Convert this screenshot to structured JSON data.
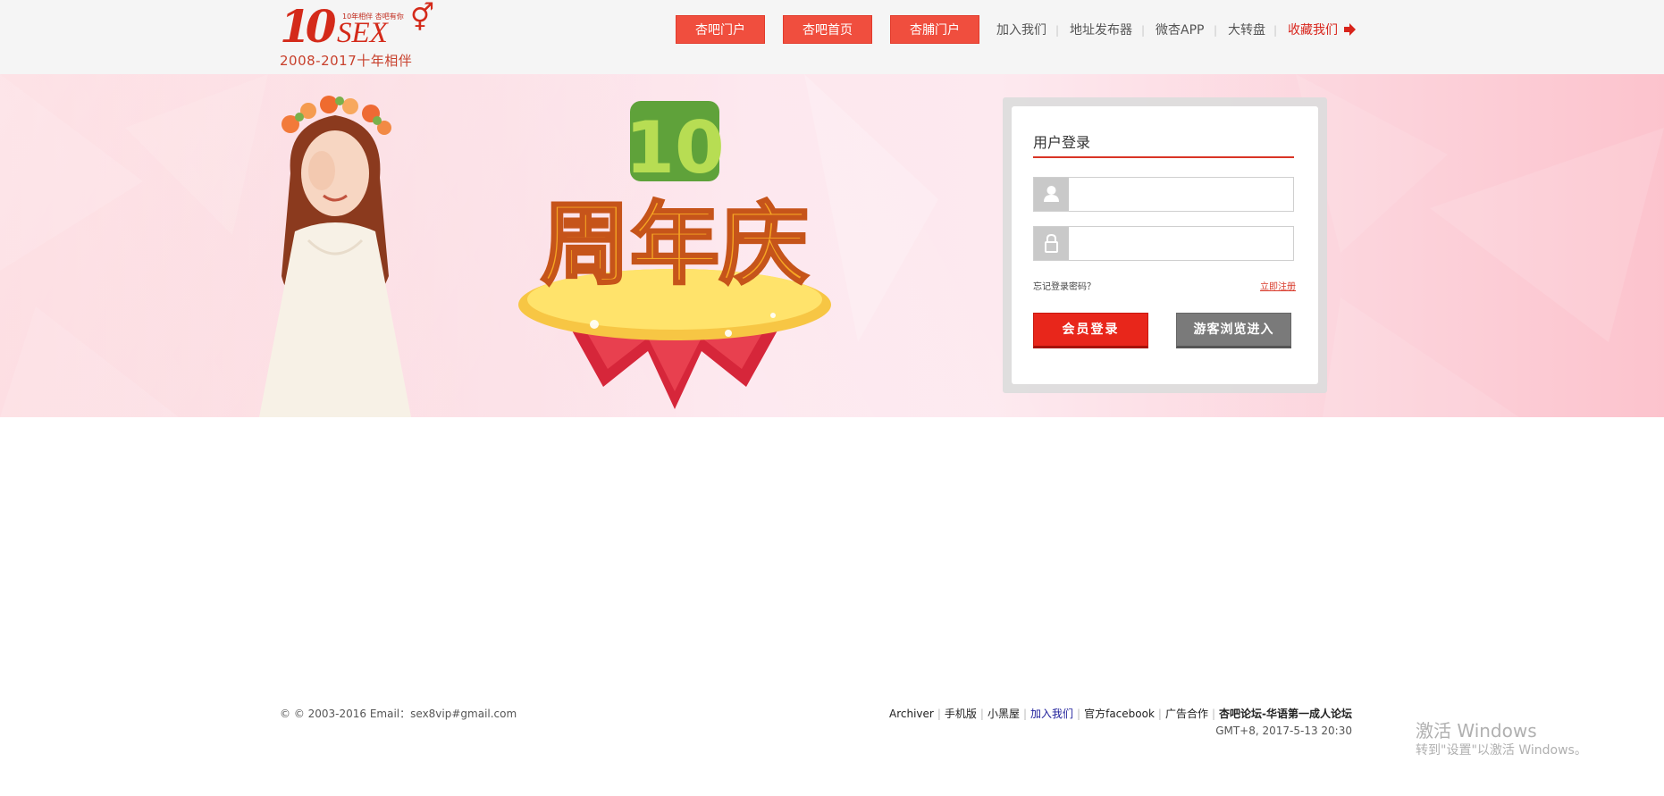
{
  "header": {
    "logo": {
      "tagline": "10年相伴 杏吧有你",
      "brand": "SEX",
      "years": "2008-2017十年相伴"
    },
    "nav_buttons": [
      {
        "label": "杏吧门户"
      },
      {
        "label": "杏吧首页"
      },
      {
        "label": "杏脯门户"
      }
    ],
    "nav_links": [
      {
        "label": "加入我们"
      },
      {
        "label": "地址发布器"
      },
      {
        "label": "微杏APP"
      },
      {
        "label": "大转盘"
      }
    ],
    "favorite_label": "收藏我们",
    "separator": "|"
  },
  "banner": {
    "anniversary_number": "10",
    "anniversary_text": "周年庆"
  },
  "login": {
    "title": "用户登录",
    "username_value": "",
    "password_value": "",
    "forgot_label": "忘记登录密码？",
    "register_label": "立即注册",
    "login_button": "会员登录",
    "guest_button": "游客浏览进入"
  },
  "footer": {
    "copyright": "© © 2003-2016 Email：sex8vip#gmail.com",
    "links": {
      "archiver": "Archiver",
      "mobile": "手机版",
      "blackroom": "小黑屋",
      "join": "加入我们",
      "facebook": "官方facebook",
      "ads": "广告合作",
      "site": "杏吧论坛-华语第一成人论坛"
    },
    "timestamp": "GMT+8, 2017-5-13 20:30"
  },
  "os_watermark": {
    "title": "激活 Windows",
    "subtitle": "转到\"设置\"以激活 Windows。"
  },
  "colors": {
    "brand_red": "#d42a1a",
    "nav_button": "#f04e3e",
    "login_button": "#e8261b",
    "guest_button": "#7a7a7a"
  }
}
